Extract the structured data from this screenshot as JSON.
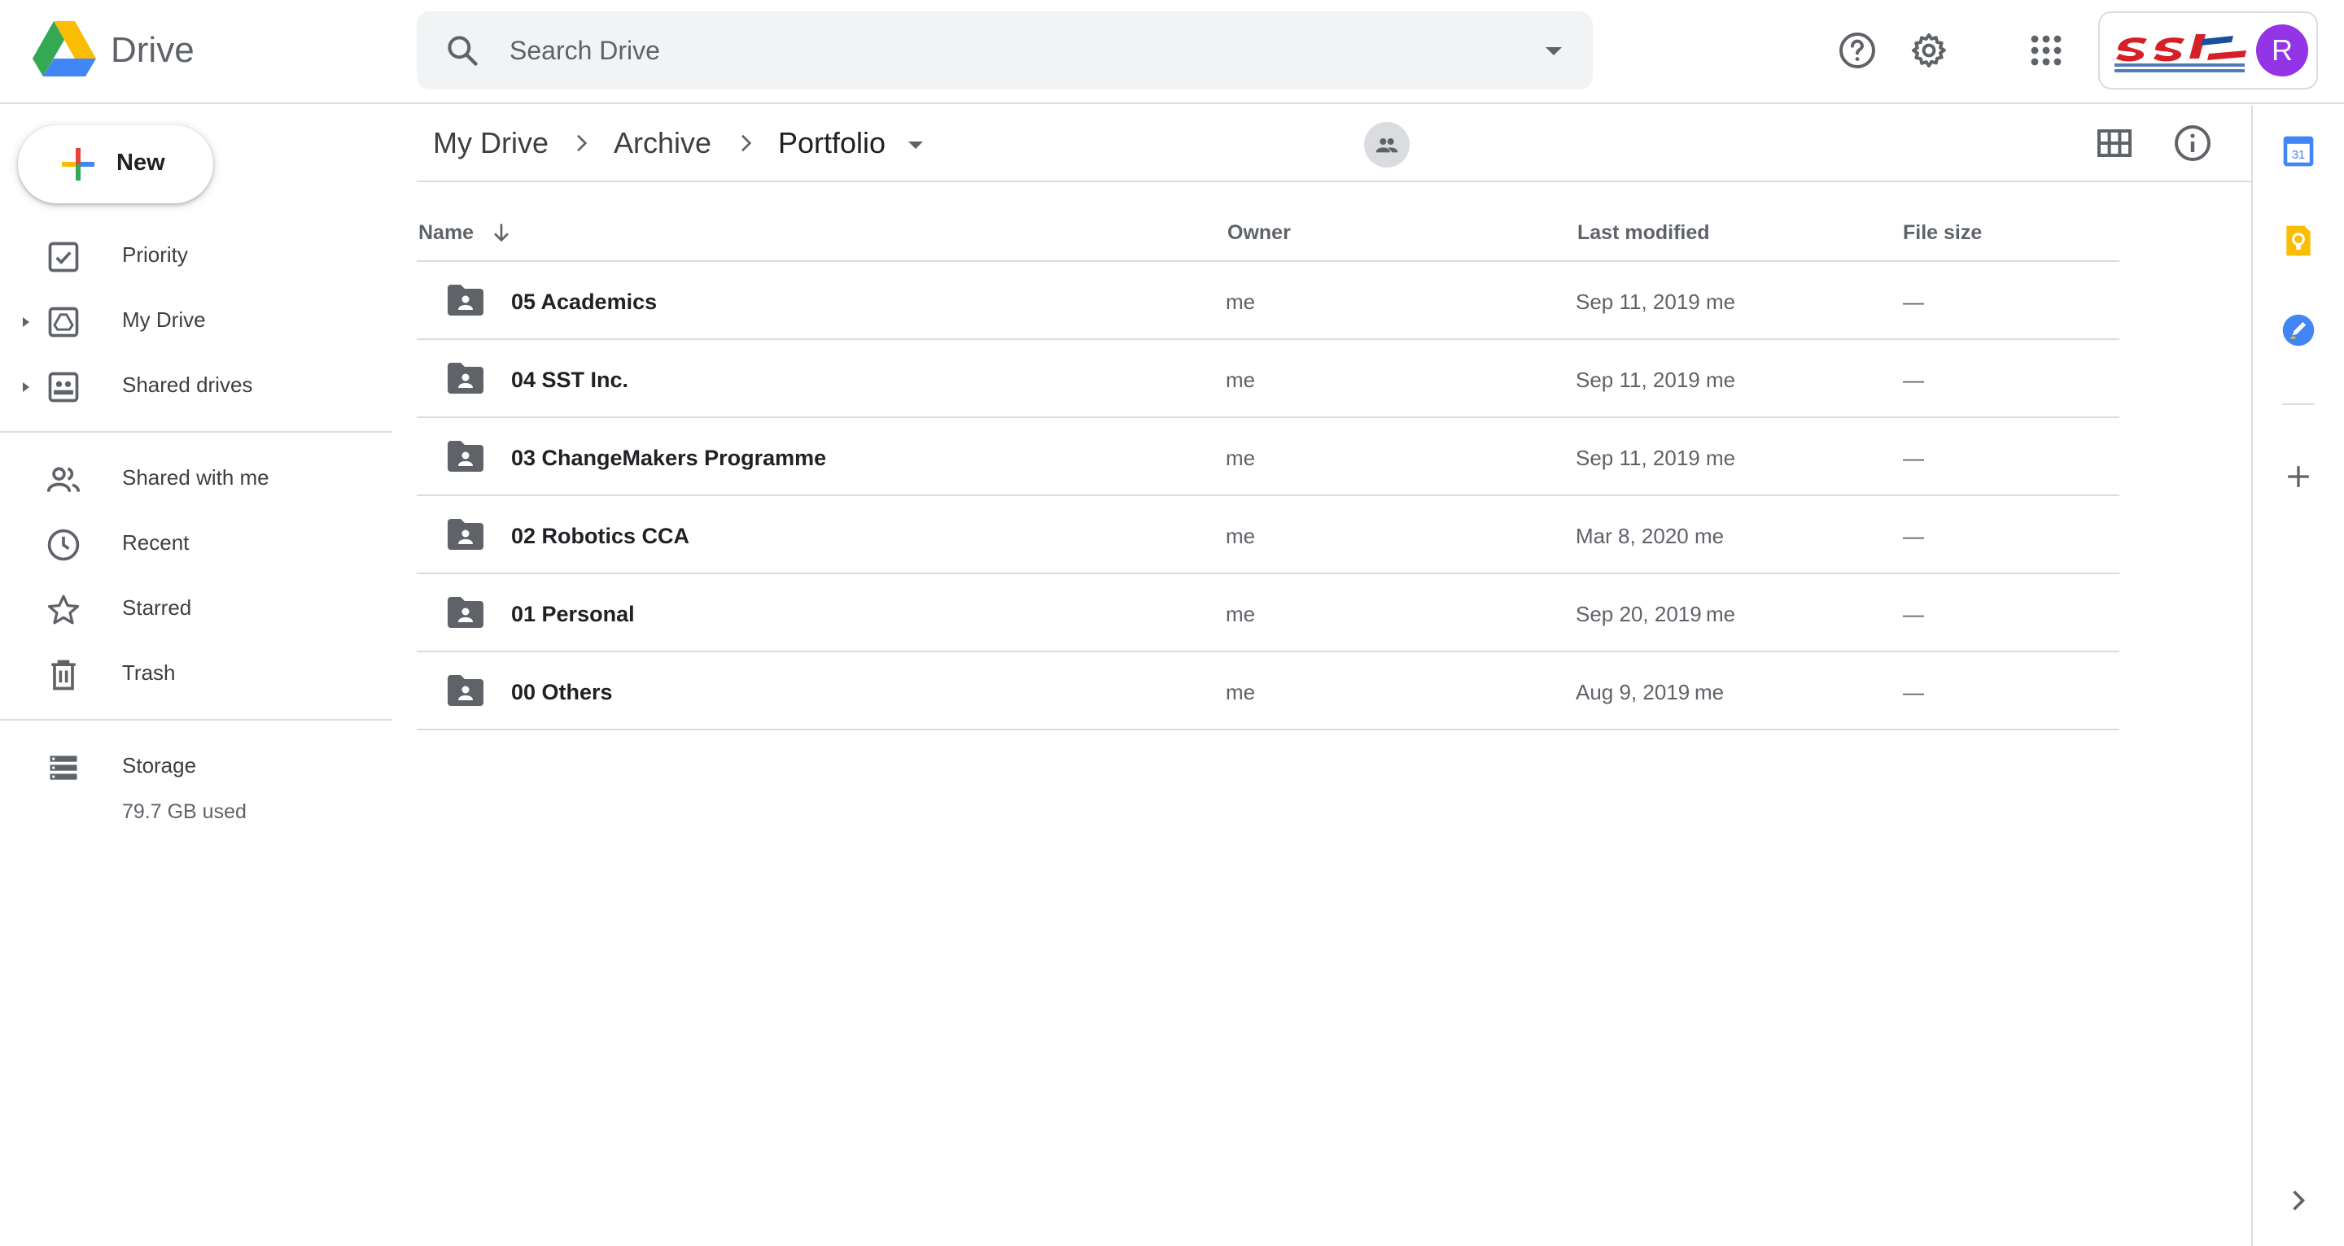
{
  "header": {
    "app_title": "Drive",
    "search_placeholder": "Search Drive",
    "avatar_letter": "R",
    "avatar_color": "#9334e6",
    "icons": [
      "drive-logo",
      "search-icon",
      "search-options-icon",
      "help-icon",
      "settings-icon",
      "apps-icon",
      "organization-logo",
      "avatar"
    ]
  },
  "nav": {
    "new_label": "New",
    "items": [
      {
        "label": "Priority",
        "icon": "priority-icon"
      },
      {
        "label": "My Drive",
        "icon": "my-drive-icon"
      },
      {
        "label": "Shared drives",
        "icon": "shared-drives-icon"
      },
      {
        "label": "Shared with me",
        "icon": "shared-with-me-icon"
      },
      {
        "label": "Recent",
        "icon": "clock-icon"
      },
      {
        "label": "Starred",
        "icon": "star-icon"
      },
      {
        "label": "Trash",
        "icon": "trash-icon"
      }
    ],
    "storage": {
      "label": "Storage",
      "used": "79.7 GB used"
    }
  },
  "breadcrumb": {
    "items": [
      "My Drive",
      "Archive",
      "Portfolio"
    ]
  },
  "table": {
    "columns": {
      "name": "Name",
      "owner": "Owner",
      "last_modified": "Last modified",
      "file_size": "File size"
    },
    "sort": {
      "column": "name",
      "direction": "descending"
    },
    "rows": [
      {
        "name": "05 Academics",
        "owner": "me",
        "modified": "Sep 11, 2019",
        "modified_by": "me",
        "size": "—"
      },
      {
        "name": "04 SST Inc.",
        "owner": "me",
        "modified": "Sep 11, 2019",
        "modified_by": "me",
        "size": "—"
      },
      {
        "name": "03 ChangeMakers Programme",
        "owner": "me",
        "modified": "Sep 11, 2019",
        "modified_by": "me",
        "size": "—"
      },
      {
        "name": "02 Robotics CCA",
        "owner": "me",
        "modified": "Mar 8, 2020",
        "modified_by": "me",
        "size": "—"
      },
      {
        "name": "01 Personal",
        "owner": "me",
        "modified": "Sep 20, 2019",
        "modified_by": "me",
        "size": "—"
      },
      {
        "name": "00 Others",
        "owner": "me",
        "modified": "Aug 9, 2019",
        "modified_by": "me",
        "size": "—"
      }
    ]
  },
  "side_panel": {
    "icons": [
      "calendar-icon",
      "keep-icon",
      "tasks-icon",
      "add-addon-icon",
      "expand-panel-icon"
    ],
    "calendar_day": "31"
  },
  "colors": {
    "google_blue": "#4285f4",
    "google_green": "#34a853",
    "google_yellow": "#fbbc04",
    "google_red": "#ea4335",
    "text_secondary": "#5f6368",
    "divider": "#dadce0"
  }
}
